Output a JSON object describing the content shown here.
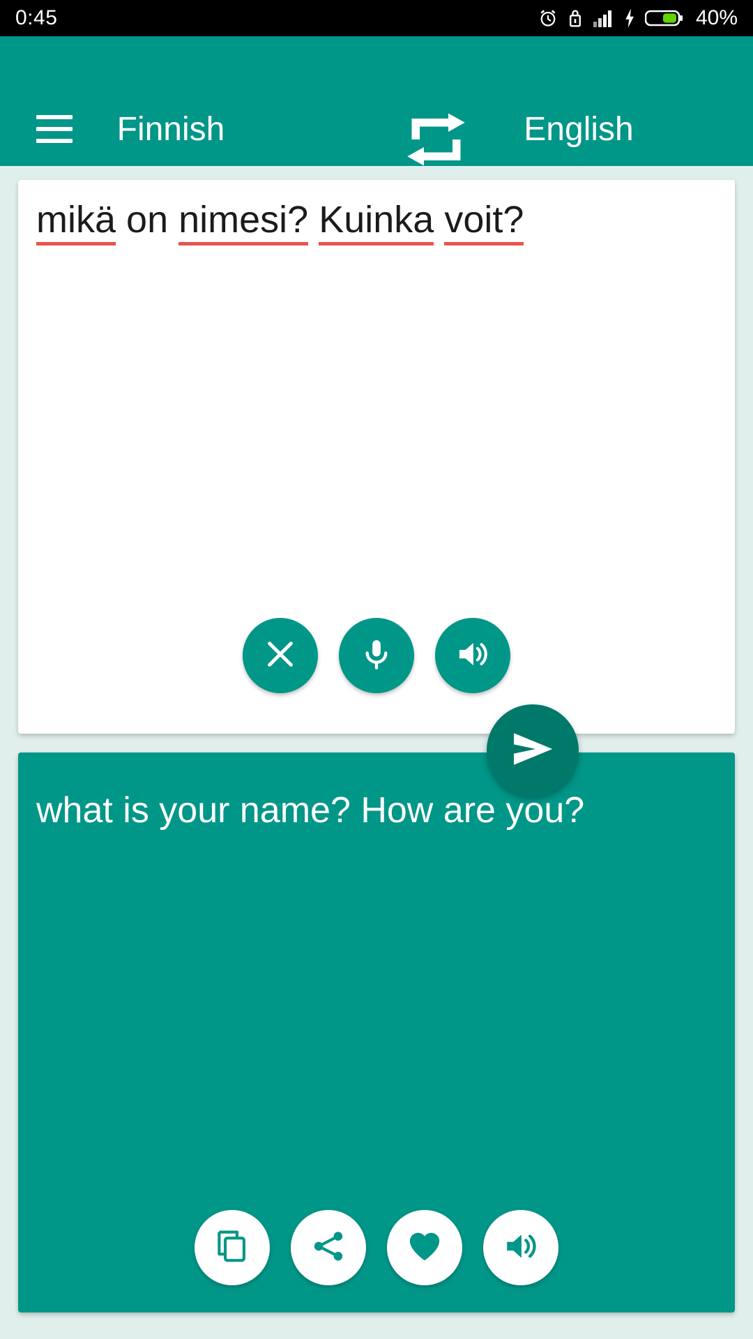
{
  "status_bar": {
    "time": "0:45",
    "battery_percent": "40%",
    "icons": [
      "alarm-icon",
      "lock-icon",
      "signal-icon",
      "charging-bolt-icon",
      "battery-icon"
    ]
  },
  "toolbar": {
    "menu_icon": "hamburger-menu-icon",
    "source_language": "Finnish",
    "swap_icon": "swap-languages-icon",
    "target_language": "English",
    "background_color": "#009688"
  },
  "input_card": {
    "text": "mikä on nimesi? Kuinka voit?",
    "tokens": [
      {
        "word": "mikä",
        "misspelled": true
      },
      {
        "word": "on",
        "misspelled": false
      },
      {
        "word": "nimesi?",
        "misspelled": true
      },
      {
        "word": "Kuinka",
        "misspelled": true
      },
      {
        "word": "voit?",
        "misspelled": true
      }
    ],
    "spellcheck_underline_color": "#e8554e",
    "actions": [
      {
        "name": "clear-button",
        "icon": "close-icon",
        "label": "Clear"
      },
      {
        "name": "microphone-button",
        "icon": "microphone-icon",
        "label": "Speak"
      },
      {
        "name": "speak-input-button",
        "icon": "speaker-icon",
        "label": "Listen"
      }
    ]
  },
  "send_button": {
    "icon": "send-icon",
    "label": "Translate",
    "color": "#00796B"
  },
  "output_card": {
    "text": "what is your name? How are you?",
    "background_color": "#009688",
    "actions": [
      {
        "name": "copy-button",
        "icon": "copy-icon",
        "label": "Copy"
      },
      {
        "name": "share-button",
        "icon": "share-icon",
        "label": "Share"
      },
      {
        "name": "favorite-button",
        "icon": "heart-icon",
        "label": "Favorite"
      },
      {
        "name": "speak-output-button",
        "icon": "speaker-icon",
        "label": "Listen"
      }
    ]
  },
  "theme": {
    "primary": "#009688",
    "primary_dark": "#00796B",
    "page_background": "#E1EFEC"
  }
}
